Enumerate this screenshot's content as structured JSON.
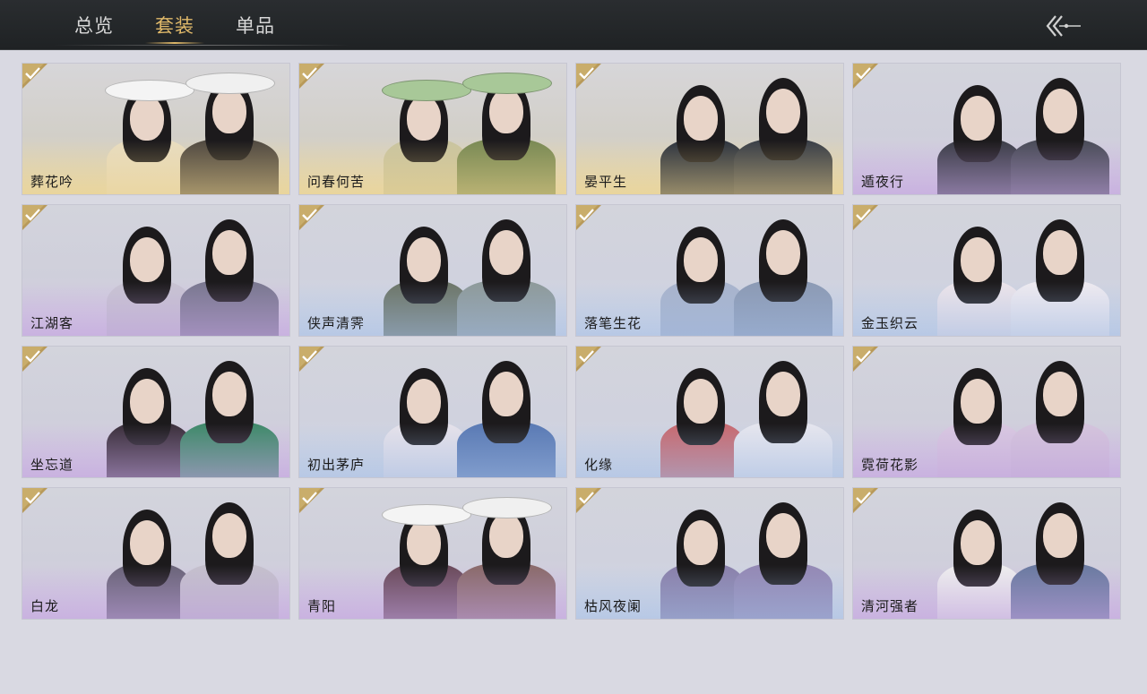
{
  "tabs": [
    {
      "label": "总览",
      "active": false
    },
    {
      "label": "套装",
      "active": true
    },
    {
      "label": "单品",
      "active": false
    }
  ],
  "back_icon": "double-chevron-left-icon",
  "colors": {
    "accent_gold": "#e0b96a",
    "topbar": "#222527",
    "page_bg": "#d9d9e2"
  },
  "outfits": [
    {
      "name": "葬花吟",
      "tint": "gold",
      "owned": true,
      "hat": "white",
      "f_cloth": "#e8dcc0",
      "m_cloth": "#514a42"
    },
    {
      "name": "问春何苦",
      "tint": "gold",
      "owned": true,
      "hat": "green",
      "f_cloth": "#c9c4a0",
      "m_cloth": "#7a8a55"
    },
    {
      "name": "晏平生",
      "tint": "gold",
      "owned": true,
      "hat": "",
      "f_cloth": "#2f3540",
      "m_cloth": "#3a3f48"
    },
    {
      "name": "遁夜行",
      "tint": "purple",
      "owned": true,
      "hat": "",
      "f_cloth": "#3c3e48",
      "m_cloth": "#4a4c58"
    },
    {
      "name": "江湖客",
      "tint": "purple",
      "owned": true,
      "hat": "",
      "f_cloth": "#c8c4d2",
      "m_cloth": "#7a7890"
    },
    {
      "name": "侠声清霁",
      "tint": "blue",
      "owned": true,
      "hat": "",
      "f_cloth": "#6d7668",
      "m_cloth": "#8e9a9a"
    },
    {
      "name": "落笔生花",
      "tint": "blue",
      "owned": true,
      "hat": "",
      "f_cloth": "#a9b4cc",
      "m_cloth": "#8c9ab4"
    },
    {
      "name": "金玉织云",
      "tint": "blue",
      "owned": true,
      "hat": "",
      "f_cloth": "#ece4ea",
      "m_cloth": "#eeeaf0"
    },
    {
      "name": "坐忘道",
      "tint": "purple",
      "owned": true,
      "hat": "",
      "f_cloth": "#3a2f3a",
      "m_cloth": "#3f8a6a"
    },
    {
      "name": "初出茅庐",
      "tint": "blue",
      "owned": true,
      "hat": "",
      "f_cloth": "#e6e2ea",
      "m_cloth": "#5a7ab4"
    },
    {
      "name": "化缘",
      "tint": "blue",
      "owned": true,
      "hat": "",
      "f_cloth": "#c86a70",
      "m_cloth": "#e6e6ee"
    },
    {
      "name": "霓荷花影",
      "tint": "purple",
      "owned": true,
      "hat": "",
      "f_cloth": "#d8c8e0",
      "m_cloth": "#d4c4dc"
    },
    {
      "name": "白龙",
      "tint": "purple",
      "owned": true,
      "hat": "",
      "f_cloth": "#6a6478",
      "m_cloth": "#c4c0cc"
    },
    {
      "name": "青阳",
      "tint": "purple",
      "owned": true,
      "hat": "white",
      "f_cloth": "#6a4a5a",
      "m_cloth": "#8a6a6a"
    },
    {
      "name": "枯风夜阑",
      "tint": "blue",
      "owned": true,
      "hat": "",
      "f_cloth": "#8a80aa",
      "m_cloth": "#9488b4"
    },
    {
      "name": "清河强者",
      "tint": "purple",
      "owned": true,
      "hat": "",
      "f_cloth": "#eeeeee",
      "m_cloth": "#6a7aa0"
    }
  ]
}
